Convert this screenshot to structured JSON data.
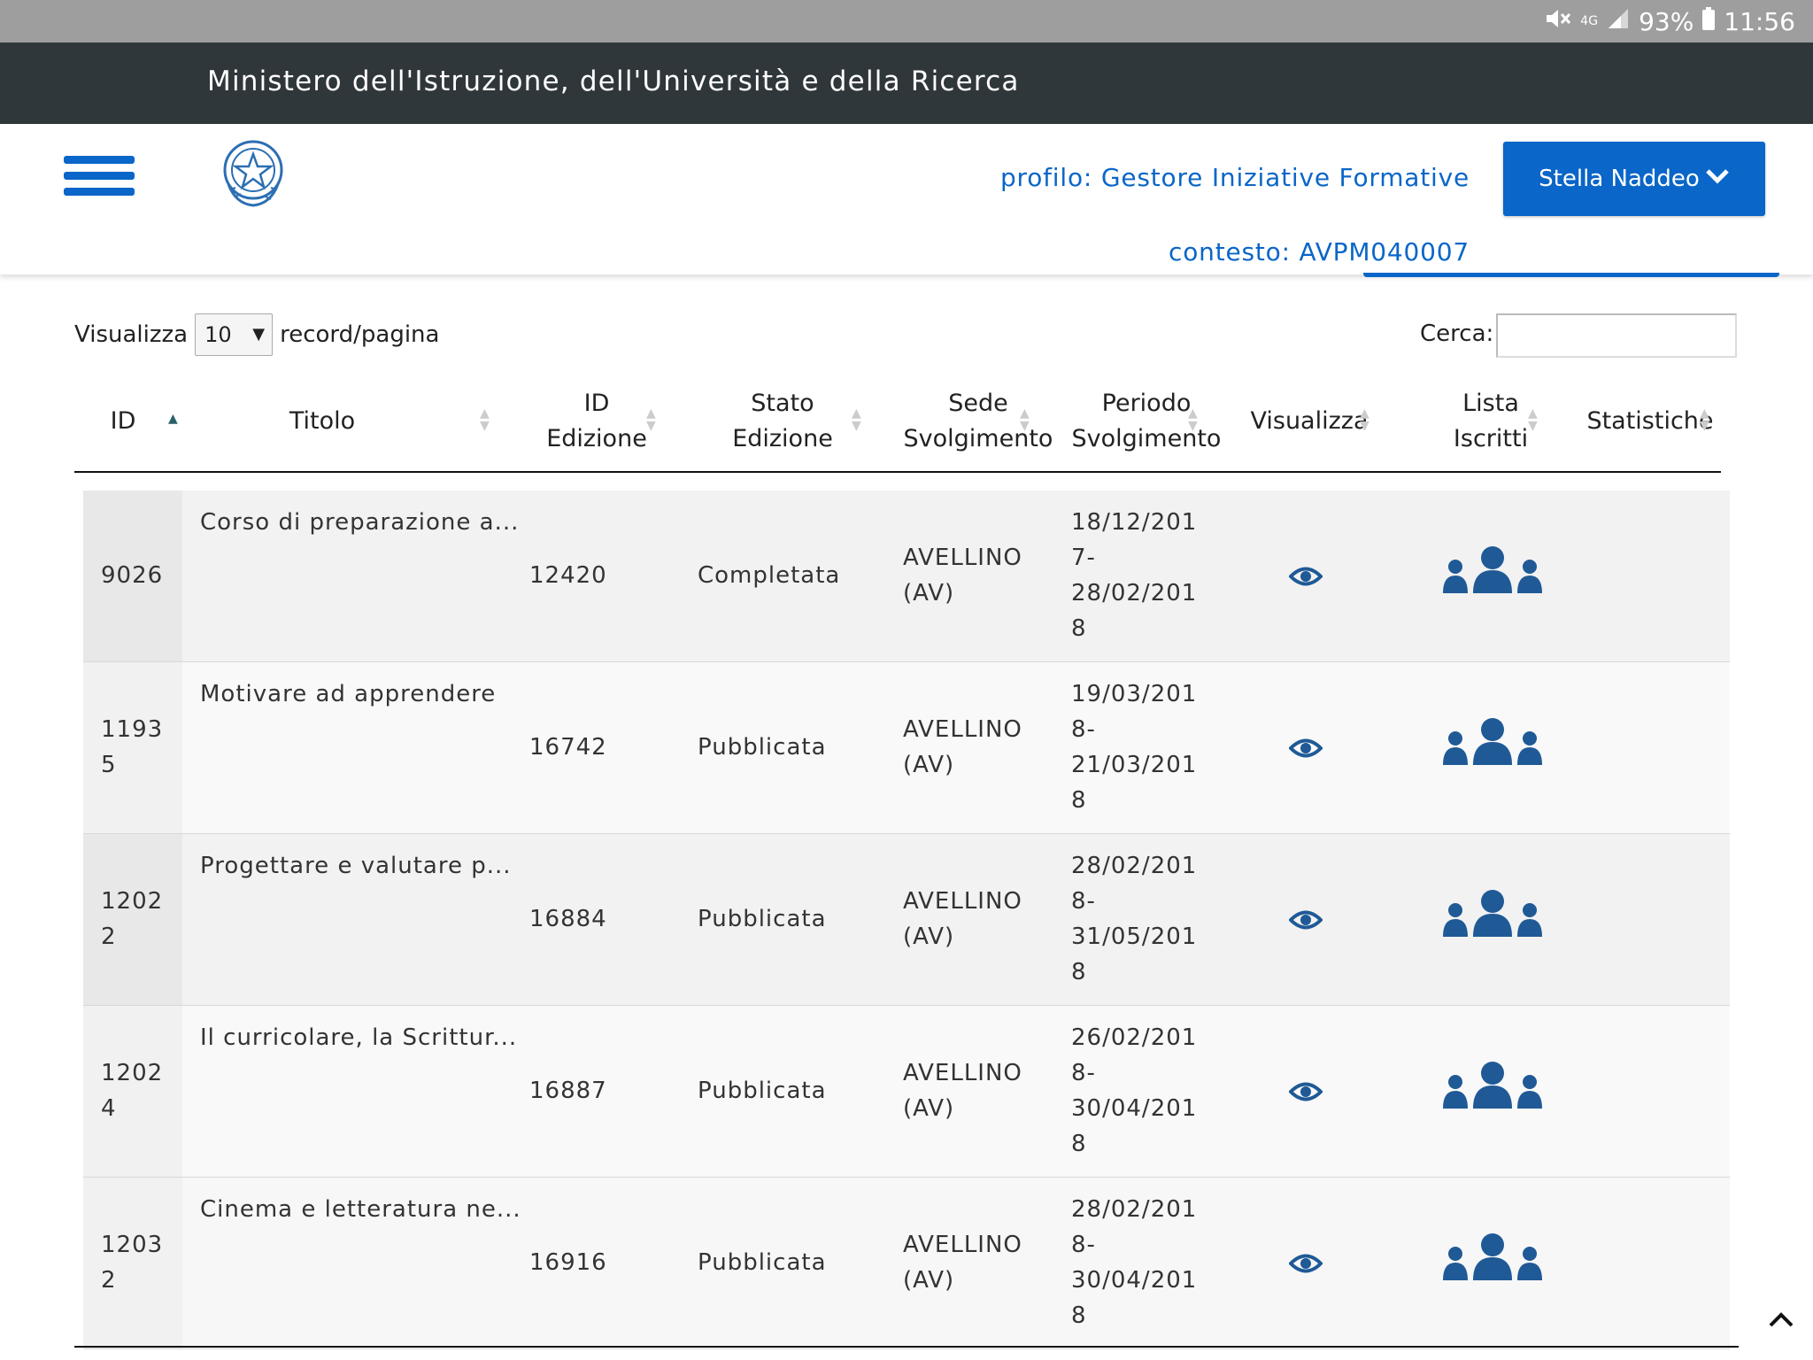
{
  "status_bar": {
    "signal_text": "4G",
    "battery": "93%",
    "time": "11:56"
  },
  "ministry_title": "Ministero dell'Istruzione, dell'Università e della Ricerca",
  "header": {
    "profilo": "profilo: Gestore Iniziative Formative",
    "contesto": "contesto: AVPM040007",
    "user_name": "Stella Naddeo"
  },
  "controls": {
    "show_label": "Visualizza",
    "page_size": "10",
    "per_page_label": "record/pagina",
    "search_label": "Cerca:",
    "search_value": ""
  },
  "columns": [
    {
      "line1": "ID",
      "line2": ""
    },
    {
      "line1": "Titolo",
      "line2": ""
    },
    {
      "line1": "ID",
      "line2": "Edizione"
    },
    {
      "line1": "Stato",
      "line2": "Edizione"
    },
    {
      "line1": "Sede",
      "line2": "Svolgimento"
    },
    {
      "line1": "Periodo",
      "line2": "Svolgimento"
    },
    {
      "line1": "Visualizza",
      "line2": ""
    },
    {
      "line1": "Lista",
      "line2": "Iscritti"
    },
    {
      "line1": "Statistiche",
      "line2": ""
    }
  ],
  "rows": [
    {
      "id1": "9026",
      "id2": "",
      "titolo": "Corso di preparazione a...",
      "edizione": "12420",
      "stato": "Completata",
      "sede1": "AVELLINO",
      "sede2": "(AV)",
      "p1": "18/12/201",
      "p2": "7-",
      "p3": "28/02/201",
      "p4": "8"
    },
    {
      "id1": "1193",
      "id2": "5",
      "titolo": "Motivare ad apprendere",
      "edizione": "16742",
      "stato": "Pubblicata",
      "sede1": "AVELLINO",
      "sede2": "(AV)",
      "p1": "19/03/201",
      "p2": "8-",
      "p3": "21/03/201",
      "p4": "8"
    },
    {
      "id1": "1202",
      "id2": "2",
      "titolo": "Progettare e valutare p...",
      "edizione": "16884",
      "stato": "Pubblicata",
      "sede1": "AVELLINO",
      "sede2": "(AV)",
      "p1": "28/02/201",
      "p2": "8-",
      "p3": "31/05/201",
      "p4": "8"
    },
    {
      "id1": "1202",
      "id2": "4",
      "titolo": "Il curricolare, la Scrittur...",
      "edizione": "16887",
      "stato": "Pubblicata",
      "sede1": "AVELLINO",
      "sede2": "(AV)",
      "p1": "26/02/201",
      "p2": "8-",
      "p3": "30/04/201",
      "p4": "8"
    },
    {
      "id1": "1203",
      "id2": "2",
      "titolo": "Cinema e letteratura ne...",
      "edizione": "16916",
      "stato": "Pubblicata",
      "sede1": "AVELLINO",
      "sede2": "(AV)",
      "p1": "28/02/201",
      "p2": "8-",
      "p3": "30/04/201",
      "p4": "8"
    }
  ],
  "colors": {
    "primary": "#0a66c8",
    "ministry_bar": "#30373b",
    "icon_blue": "#1f5a96"
  }
}
